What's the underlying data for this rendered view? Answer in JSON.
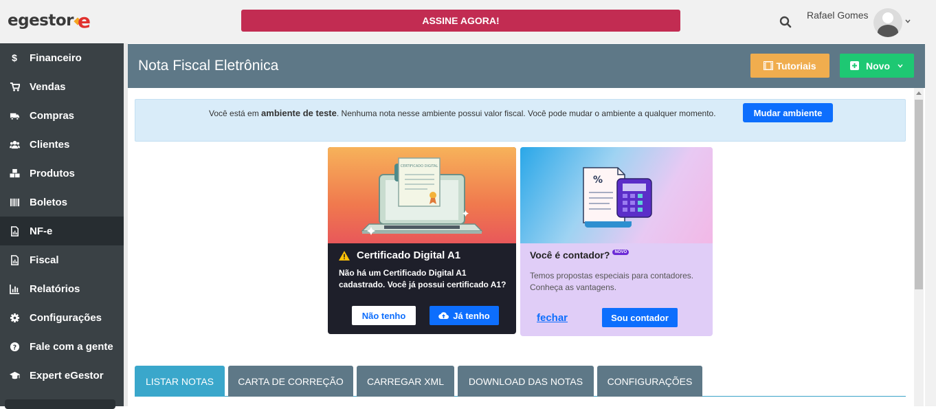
{
  "topbar": {
    "logo_text": "egestor",
    "subscribe_label": "ASSINE AGORA!",
    "user_name": "Rafael Gomes"
  },
  "sidebar": {
    "items": [
      {
        "label": "Financeiro",
        "icon": "dollar-icon"
      },
      {
        "label": "Vendas",
        "icon": "cart-icon"
      },
      {
        "label": "Compras",
        "icon": "truck-icon"
      },
      {
        "label": "Clientes",
        "icon": "users-icon"
      },
      {
        "label": "Produtos",
        "icon": "cubes-icon"
      },
      {
        "label": "Boletos",
        "icon": "barcode-icon"
      },
      {
        "label": "NF-e",
        "icon": "document-icon",
        "active": true
      },
      {
        "label": "Fiscal",
        "icon": "document-icon"
      },
      {
        "label": "Relatórios",
        "icon": "bar-chart-icon"
      },
      {
        "label": "Configurações",
        "icon": "gear-icon"
      },
      {
        "label": "Fale com a gente",
        "icon": "question-icon"
      },
      {
        "label": "Expert eGestor",
        "icon": "graduation-cap-icon"
      }
    ]
  },
  "header": {
    "title": "Nota Fiscal Eletrônica",
    "tutoriais_label": "Tutoriais",
    "novo_label": "Novo"
  },
  "alert": {
    "text_before": "Você está em ",
    "text_bold": "ambiente de teste",
    "text_after": ". Nenhuma nota nesse ambiente possui valor fiscal. Você pode mudar o ambiente a qualquer momento.",
    "button_label": "Mudar ambiente"
  },
  "cert_card": {
    "title": "Certificado Digital A1",
    "text": "Não há um Certificado Digital A1 cadastrado. Você já possui certificado A1?",
    "no_label": "Não tenho",
    "yes_label": "Já tenho",
    "illus_text": "CERTIFICADO DIGITAL"
  },
  "contador_card": {
    "title": "Você é contador?",
    "badge": "NOVO",
    "text": "Temos propostas especiais para contadores. Conheça as vantagens.",
    "close_label": "fechar",
    "button_label": "Sou contador"
  },
  "tabs": [
    {
      "label": "LISTAR NOTAS",
      "active": true
    },
    {
      "label": "CARTA DE CORREÇÃO"
    },
    {
      "label": "CARREGAR XML"
    },
    {
      "label": "DOWNLOAD DAS NOTAS"
    },
    {
      "label": "CONFIGURAÇÕES"
    }
  ],
  "colors": {
    "sidebar_bg": "#3a4145",
    "header_bg": "#5e7887",
    "subscribe_bg": "#c22c52",
    "primary": "#0d6efd",
    "tutoriais_bg": "#f0ad4e",
    "novo_bg": "#1ec873",
    "tab_active": "#3aa7cb"
  }
}
